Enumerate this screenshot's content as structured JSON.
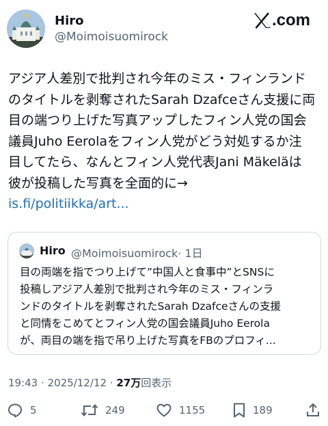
{
  "author": {
    "name": "Hiro",
    "handle": "@Moimoisuomirock",
    "avatar_icon": "avatar-cathedral-icon"
  },
  "brand": {
    "logo_icon": "x-logo-icon",
    "label": ".com"
  },
  "tweet": {
    "lines": [
      "アジア人差別で批判され今年のミス・フィンランド",
      "のタイトルを剥奪されたSarah Dzafceさん支援に両",
      "目の端つり上げた写真アップしたフィン人党の国会",
      "議員Juho Eerolaをフィン人党がどう対処するか注",
      "目してたら、なんとフィン人党代表Jani Mäkeläは",
      "彼が投稿した写真を全面的に→"
    ],
    "link": "is.fi/politiikka/art..."
  },
  "quote": {
    "name": "Hiro",
    "handle": "@Moimoisuomirock",
    "time": "· 1日",
    "lines": [
      "目の両端を指でつり上げて”中国人と食事中”とSNSに",
      "投稿しアジア人差別で批判され今年のミス・フィンラ",
      "ンドのタイトルを剥奪されたSarah Dzafceさんの支援",
      "と同情をこめてとフィン人党の国会議員Juho Eerola",
      "が、両目の端を指で吊り上げた写真をFBのプロフィ..."
    ]
  },
  "meta": {
    "time": "19:43",
    "separator": "·",
    "date": "2025/12/12",
    "views_count": "27万",
    "views_label": "回表示"
  },
  "actions": {
    "reply_count": "5",
    "repost_count": "249",
    "like_count": "1155",
    "bookmark_count": "189"
  },
  "colors": {
    "text": "#0f1419",
    "secondary": "#536471",
    "link": "#1d6fb8",
    "border": "#cfd9de"
  }
}
